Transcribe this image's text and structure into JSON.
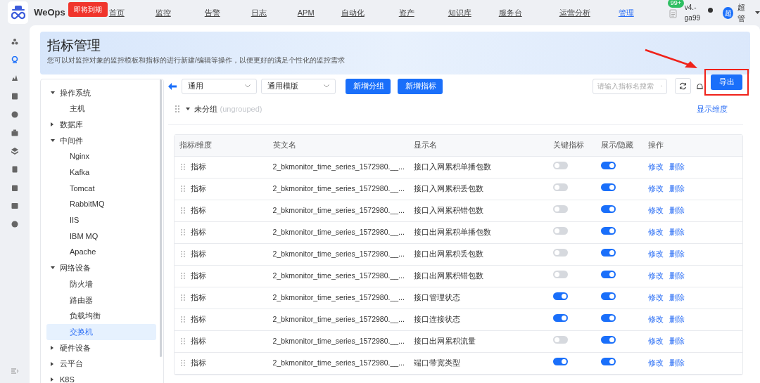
{
  "brand": {
    "name": "WeOps",
    "badge": "即将到期"
  },
  "nav": [
    {
      "label": "首页",
      "selected": false
    },
    {
      "label": "监控",
      "selected": false
    },
    {
      "label": "告警",
      "selected": false
    },
    {
      "label": "日志",
      "selected": false
    },
    {
      "label": "APM",
      "selected": false
    },
    {
      "label": "自动化",
      "selected": false
    },
    {
      "label": "资产",
      "selected": false
    },
    {
      "label": "知识库",
      "selected": false
    },
    {
      "label": "服务台",
      "selected": false
    },
    {
      "label": "运营分析",
      "selected": false
    },
    {
      "label": "管理",
      "selected": true
    }
  ],
  "header_right": {
    "notice_count": "99+",
    "version": "v4.-ga99",
    "avatar": "超",
    "user": "超管"
  },
  "page": {
    "title": "指标管理",
    "subtitle": "您可以对监控对象的监控模板和指标的进行新建/编辑等操作，以便更好的满足个性化的监控需求"
  },
  "tree": [
    {
      "label": "操作系统",
      "expanded": true,
      "selected": false,
      "children": [
        {
          "label": "主机",
          "selected": false
        }
      ]
    },
    {
      "label": "数据库",
      "expanded": false,
      "selected": false
    },
    {
      "label": "中间件",
      "expanded": true,
      "selected": false,
      "children": [
        {
          "label": "Nginx",
          "selected": false
        },
        {
          "label": "Kafka",
          "selected": false
        },
        {
          "label": "Tomcat",
          "selected": false
        },
        {
          "label": "RabbitMQ",
          "selected": false
        },
        {
          "label": "IIS",
          "selected": false
        },
        {
          "label": "IBM MQ",
          "selected": false
        },
        {
          "label": "Apache",
          "selected": false
        }
      ]
    },
    {
      "label": "网络设备",
      "expanded": true,
      "selected": false,
      "children": [
        {
          "label": "防火墙",
          "selected": false
        },
        {
          "label": "路由器",
          "selected": false
        },
        {
          "label": "负载均衡",
          "selected": false
        },
        {
          "label": "交换机",
          "selected": true
        }
      ]
    },
    {
      "label": "硬件设备",
      "expanded": false,
      "selected": false
    },
    {
      "label": "云平台",
      "expanded": false,
      "selected": false
    },
    {
      "label": "K8S",
      "expanded": false,
      "selected": false
    }
  ],
  "toolbar": {
    "select_1": "通用",
    "select_2": "通用模版",
    "buttons": [
      "新增分组",
      "新增指标"
    ],
    "search_placeholder": "请输入指标名搜索",
    "export": "导出"
  },
  "group": {
    "name": "未分组",
    "hint": "(ungrouped)",
    "expanded": true,
    "link": "显示维度"
  },
  "table": {
    "columns": [
      "指标/维度",
      "英文名",
      "显示名",
      "关键指标",
      "展示/隐藏",
      "操作"
    ],
    "rows": [
      {
        "type": "指标",
        "en": "2_bkmonitor_time_series_1572980.__...",
        "name": "接口入网累积单播包数",
        "key": false,
        "shown": true,
        "actions": [
          "修改",
          "删除"
        ]
      },
      {
        "type": "指标",
        "en": "2_bkmonitor_time_series_1572980.__...",
        "name": "接口入网累积丢包数",
        "key": false,
        "shown": true,
        "actions": [
          "修改",
          "删除"
        ]
      },
      {
        "type": "指标",
        "en": "2_bkmonitor_time_series_1572980.__...",
        "name": "接口入网累积错包数",
        "key": false,
        "shown": true,
        "actions": [
          "修改",
          "删除"
        ]
      },
      {
        "type": "指标",
        "en": "2_bkmonitor_time_series_1572980.__...",
        "name": "接口出网累积单播包数",
        "key": false,
        "shown": true,
        "actions": [
          "修改",
          "删除"
        ]
      },
      {
        "type": "指标",
        "en": "2_bkmonitor_time_series_1572980.__...",
        "name": "接口出网累积丢包数",
        "key": false,
        "shown": true,
        "actions": [
          "修改",
          "删除"
        ]
      },
      {
        "type": "指标",
        "en": "2_bkmonitor_time_series_1572980.__...",
        "name": "接口出网累积错包数",
        "key": false,
        "shown": true,
        "actions": [
          "修改",
          "删除"
        ]
      },
      {
        "type": "指标",
        "en": "2_bkmonitor_time_series_1572980.__...",
        "name": "接口管理状态",
        "key": true,
        "shown": true,
        "actions": [
          "修改",
          "删除"
        ]
      },
      {
        "type": "指标",
        "en": "2_bkmonitor_time_series_1572980.__...",
        "name": "接口连接状态",
        "key": true,
        "shown": true,
        "actions": [
          "修改",
          "删除"
        ]
      },
      {
        "type": "指标",
        "en": "2_bkmonitor_time_series_1572980.__...",
        "name": "接口出网累积流量",
        "key": false,
        "shown": true,
        "actions": [
          "修改",
          "删除"
        ]
      },
      {
        "type": "指标",
        "en": "2_bkmonitor_time_series_1572980.__...",
        "name": "端口带宽类型",
        "key": true,
        "shown": true,
        "actions": [
          "修改",
          "删除"
        ]
      }
    ]
  }
}
